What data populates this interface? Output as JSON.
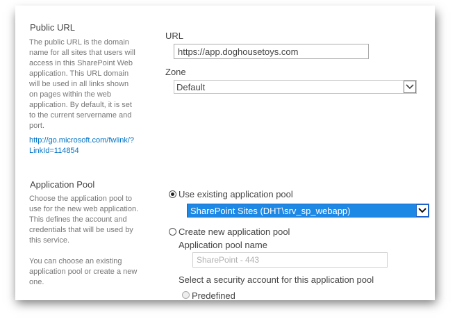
{
  "public_url": {
    "title": "Public URL",
    "description": "The public URL is the domain\nname for all sites that users will\naccess in this SharePoint Web\napplication.  This URL domain\nwill be used in all links shown\non pages within the web\napplication.  By default, it is set\nto the current servername and\nport.",
    "help_link": "http://go.microsoft.com/fwlink/?\nLinkId=114854",
    "url_label": "URL",
    "url_value": "https://app.doghousetoys.com",
    "zone_label": "Zone",
    "zone_value": "Default"
  },
  "application_pool": {
    "title": "Application Pool",
    "description": "Choose the application pool to\nuse for the new web application.\nThis defines the account and\ncredentials that will be used by\nthis service.\n\nYou can choose an existing\napplication pool or create a new\none.",
    "use_existing_label": "Use existing application pool",
    "use_existing_checked": true,
    "existing_pool_value": "SharePoint Sites (DHT\\srv_sp_webapp)",
    "create_new_label": "Create new application pool",
    "create_new_checked": false,
    "pool_name_label": "Application pool name",
    "pool_name_value": "SharePoint - 443",
    "security_account_label": "Select a security account for this application pool",
    "predefined_label": "Predefined"
  },
  "icons": {
    "dropdown": "chevron-down-icon",
    "radio": "radio-icon"
  },
  "colors": {
    "link": "#0072c6",
    "selected_dropdown": "#1e88e5"
  }
}
